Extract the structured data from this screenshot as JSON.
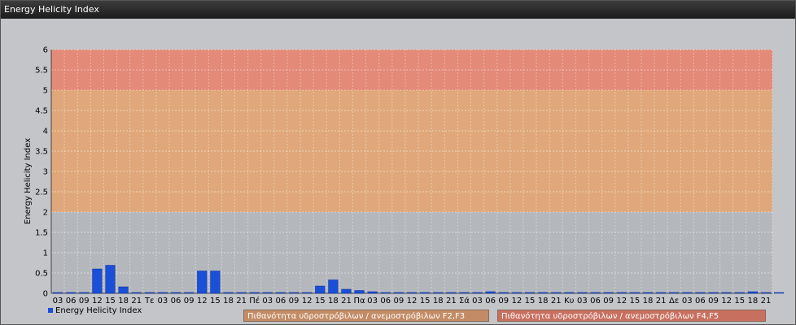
{
  "window": {
    "title": "Energy Helicity Index"
  },
  "chart_data": {
    "type": "bar",
    "ylabel": "Energy Helicity Index",
    "ylim": [
      0,
      6
    ],
    "yticks": [
      0,
      0.5,
      1,
      1.5,
      2,
      2.5,
      3,
      3.5,
      4,
      4.5,
      5,
      5.5,
      6
    ],
    "categories": [
      "03",
      "06",
      "09",
      "12",
      "15",
      "18",
      "21",
      "Τε",
      "03",
      "06",
      "09",
      "12",
      "15",
      "18",
      "21",
      "Πέ",
      "03",
      "06",
      "09",
      "12",
      "15",
      "18",
      "21",
      "Πα",
      "03",
      "06",
      "09",
      "12",
      "15",
      "18",
      "21",
      "Σά",
      "03",
      "06",
      "09",
      "12",
      "15",
      "18",
      "21",
      "Κυ",
      "03",
      "06",
      "09",
      "12",
      "15",
      "18",
      "21",
      "Δε",
      "03",
      "06",
      "09",
      "12",
      "15",
      "18",
      "21"
    ],
    "series": [
      {
        "name": "Energy Helicity Index",
        "color": "#1a4fd8",
        "values": [
          0.01,
          0.01,
          0.02,
          0.6,
          0.69,
          0.16,
          0.01,
          0.01,
          0.01,
          0.01,
          0.02,
          0.55,
          0.55,
          0.01,
          0.01,
          0.01,
          0.01,
          0.01,
          0.01,
          0.01,
          0.18,
          0.33,
          0.1,
          0.07,
          0.04,
          0.01,
          0.01,
          0.01,
          0.01,
          0.01,
          0.01,
          0.01,
          0.02,
          0.04,
          0.02,
          0.01,
          0.01,
          0.01,
          0.01,
          0.01,
          0.02,
          0.01,
          0.01,
          0.01,
          0.01,
          0.01,
          0.01,
          0.01,
          0.01,
          0.01,
          0.01,
          0.01,
          0.01,
          0.04,
          0.02,
          0.02
        ]
      }
    ],
    "zones": [
      {
        "from": 2,
        "to": 5,
        "color": "#e0a87a",
        "label": "Πιθανότητα υδροστρόβιλων / ανεμοστρόβιλων F2,F3"
      },
      {
        "from": 5,
        "to": 6,
        "color": "#e48a78",
        "label": "Πιθανότητα υδροστρόβιλων / ανεμοστρόβιλων F4,F5"
      }
    ],
    "grid": true,
    "legend": "bottom-left"
  }
}
